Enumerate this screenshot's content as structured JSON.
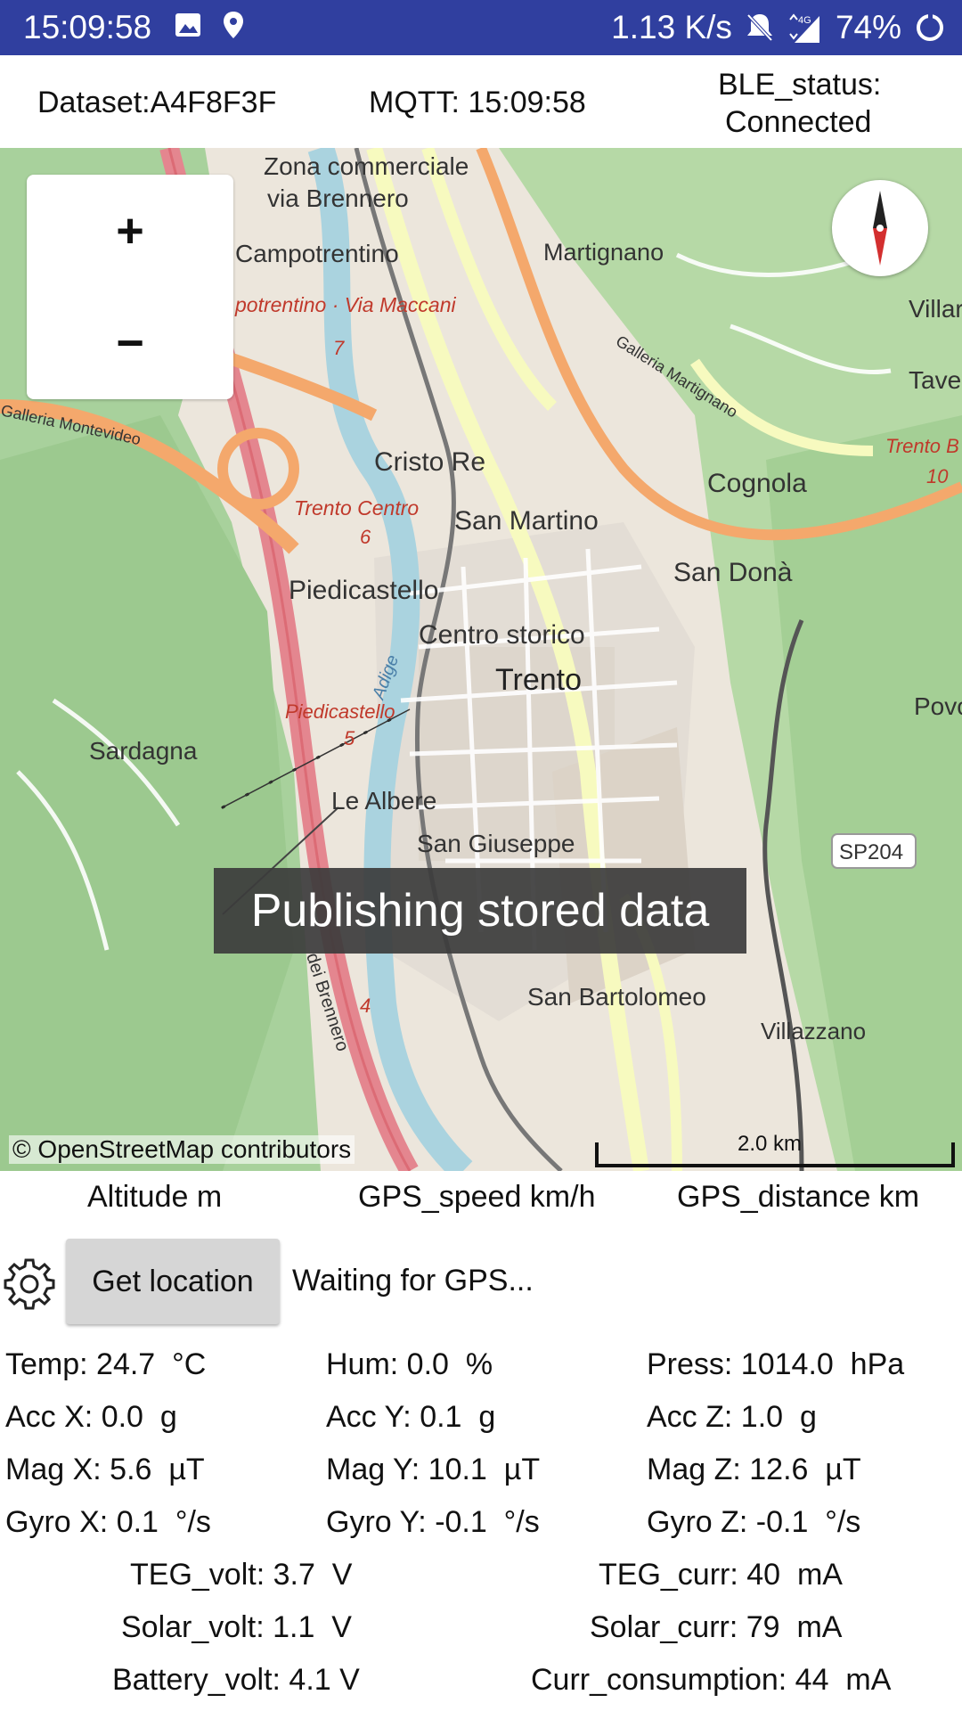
{
  "statusbar": {
    "time": "15:09:58",
    "net_speed": "1.13 K/s",
    "battery": "74%",
    "icons": [
      "image-icon",
      "location-pin-icon",
      "mute-icon",
      "signal-4g-icon",
      "battery-ring-icon"
    ]
  },
  "info": {
    "dataset": "Dataset:A4F8F3F",
    "mqtt": "MQTT: 15:09:58",
    "ble_line1": "BLE_status:",
    "ble_line2": "Connected"
  },
  "map": {
    "zoom_in": "+",
    "zoom_out": "−",
    "toast": "Publishing stored data",
    "attribution": "© OpenStreetMap contributors",
    "scale": "2.0 km",
    "labels": {
      "zona": "Zona commerciale",
      "brennero": "via Brennero",
      "campotrentino": "Campotrentino",
      "maccani": "potrentino · Via Maccani",
      "martignano": "Martignano",
      "villar": "Villar",
      "tave": "Tave",
      "galleria_m": "Galleria Martignano",
      "galleria_mv": "Galleria Montevideo",
      "cristo": "Cristo Re",
      "trento_centro": "Trento Centro",
      "trento_b": "Trento B",
      "cognola": "Cognola",
      "san_martino": "San Martino",
      "san_dona": "San Donà",
      "piedicastello": "Piedicastello",
      "centro_storico": "Centro storico",
      "trento": "Trento",
      "adige": "Adige",
      "piedicastello_exit": "Piedicastello",
      "povo": "Povo",
      "sardagna": "Sardagna",
      "le_albere": "Le Albere",
      "san_giuseppe": "San Giuseppe",
      "sp204": "SP204",
      "san_bartolomeo": "San Bartolomeo",
      "villazzano": "Villazzano",
      "del_brennero": "dei Brennero",
      "num_7": "7",
      "num_6": "6",
      "num_5": "5",
      "num_4": "4",
      "num_10": "10"
    }
  },
  "gps": {
    "altitude": "Altitude m",
    "speed": "GPS_speed km/h",
    "distance": "GPS_distance km"
  },
  "controls": {
    "get_location": "Get location",
    "waiting": "Waiting for GPS..."
  },
  "sensors": {
    "temp": "Temp: 24.7  °C",
    "hum": "Hum: 0.0  %",
    "press": "Press: 1014.0  hPa",
    "acc_x": "Acc X: 0.0  g",
    "acc_y": "Acc Y: 0.1  g",
    "acc_z": "Acc Z: 1.0  g",
    "mag_x": "Mag X: 5.6  µT",
    "mag_y": "Mag Y: 10.1  µT",
    "mag_z": "Mag Z: 12.6  µT",
    "gyro_x": "Gyro X: 0.1  °/s",
    "gyro_y": "Gyro Y: -0.1  °/s",
    "gyro_z": "Gyro Z: -0.1  °/s",
    "teg_volt": "TEG_volt: 3.7  V",
    "teg_curr": "TEG_curr: 40  mA",
    "solar_volt": "Solar_volt: 1.1  V",
    "solar_curr": "Solar_curr: 79  mA",
    "battery_volt": "Battery_volt: 4.1 V",
    "curr_consumption": "Curr_consumption: 44  mA"
  }
}
